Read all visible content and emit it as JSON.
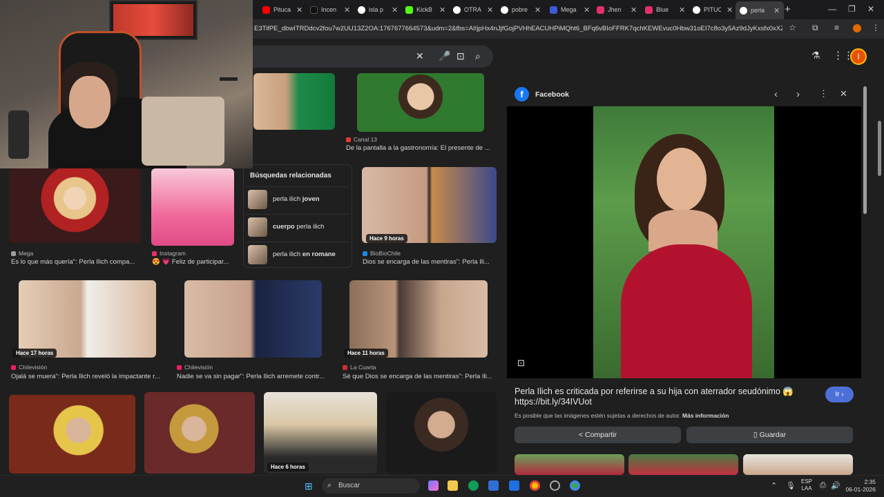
{
  "browser": {
    "tabs": [
      {
        "label": "Pituca",
        "color": "#ff0000"
      },
      {
        "label": "Incen",
        "color": "#111111"
      },
      {
        "label": "isla p",
        "color": "#ffffff"
      },
      {
        "label": "KickB",
        "color": "#53fc18"
      },
      {
        "label": "OTRA",
        "color": "#ffffff"
      },
      {
        "label": "pobre",
        "color": "#ffffff"
      },
      {
        "label": "Mega",
        "color": "#3b5bdb"
      },
      {
        "label": "Jhen",
        "color": "#e1306c"
      },
      {
        "label": "Blue",
        "color": "#e1306c"
      },
      {
        "label": "PITUC",
        "color": "#ffffff"
      },
      {
        "label": "perla",
        "color": "#ffffff"
      }
    ],
    "url": "E3TifPE_dbwITRDdcv2fou7w2UU13Z2OA:1767677664573&udm=2&fbs=AIIjpHx4nJjfGojPVHhEACUHPiMQht6_BFq6vBIoFFRK7qchKEWEvuc0Hbw31oEI7c8o3y5Az9dJyKxsfx0xXZG1h0pUg..."
  },
  "search": {
    "value": ""
  },
  "results": [
    {
      "source": "Canal 13",
      "title": "De la pantalla a la gastronomía: El presente de ...",
      "src_color": "#e53935"
    },
    {
      "source": "Mega",
      "title": "Es lo que más quería\": Perla Ilich compa...",
      "src_color": "#9e9e9e"
    },
    {
      "source": "Instagram",
      "title": "😍 💗 Feliz de participar...",
      "src_color": "#e1306c"
    },
    {
      "source": "BioBioChile",
      "title": "Dios se encarga de las mentiras\": Perla Ili...",
      "src_color": "#1e88e5",
      "badge": "Hace 9 horas"
    },
    {
      "source": "Chilevisión",
      "title": "Ojalá se muera\": Perla Ilich reveló la impactante r...",
      "src_color": "#e91e63",
      "badge": "Hace 17 horas"
    },
    {
      "source": "Chilevisión",
      "title": "Nadie se va sin pagar\": Perla Ilich arremete contr...",
      "src_color": "#e91e63"
    },
    {
      "source": "La Cuarta",
      "title": "Sé que Dios se encarga de las mentiras\": Perla Ili...",
      "src_color": "#d32f2f",
      "badge": "Hace 11 horas"
    }
  ],
  "bottom_badge": "Hace 6 horas",
  "related": {
    "title": "Búsquedas relacionadas",
    "items": [
      {
        "pre": "perla ilich ",
        "bold": "joven",
        "post": ""
      },
      {
        "pre": "",
        "bold": "cuerpo",
        "post": " perla ilich"
      },
      {
        "pre": "perla ilich ",
        "bold": "en romane",
        "post": ""
      }
    ]
  },
  "panel": {
    "source": "Facebook",
    "caption": "Perla Ilich es criticada por referirse a su hija con aterrador seudónimo 😱 https://bit.ly/34IVUot",
    "go_label": "Ir ›",
    "copyright": "Es posible que las imágenes estén sujetas a derechos de autor.",
    "more_info": "Más información",
    "share_label": "Compartir",
    "save_label": "Guardar"
  },
  "taskbar": {
    "search_placeholder": "Buscar",
    "lang_1": "ESP",
    "lang_2": "LAA",
    "time": "2:35",
    "date": "06-01-2026"
  }
}
